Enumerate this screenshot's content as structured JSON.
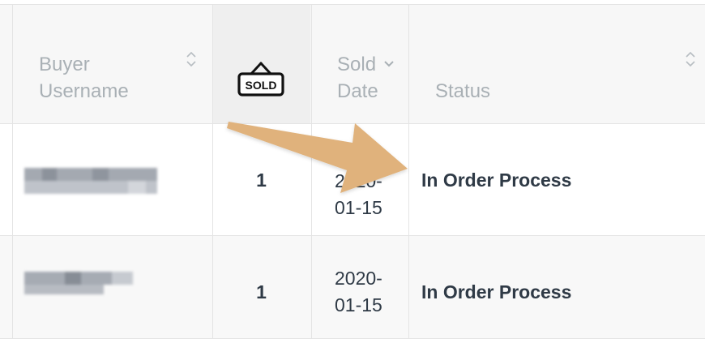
{
  "header": {
    "buyer_username": "Buyer\nUsername",
    "sold_date": "Sold\nDate",
    "status": "Status",
    "sold_icon_label": "SOLD"
  },
  "rows": [
    {
      "quantity": "1",
      "sold_date": "2020-\n01-15",
      "status": "In Order Process"
    },
    {
      "quantity": "1",
      "sold_date": "2020-\n01-15",
      "status": "In Order Process"
    }
  ],
  "icons": {
    "sort": "sort-both-icon",
    "sort_desc": "chevron-down-icon",
    "sold": "sold-sign-icon",
    "annotation": "arrow-annotation"
  },
  "colors": {
    "header_text": "#a9b0b5",
    "body_text": "#2f3a46",
    "arrow": "#e0b27b"
  }
}
